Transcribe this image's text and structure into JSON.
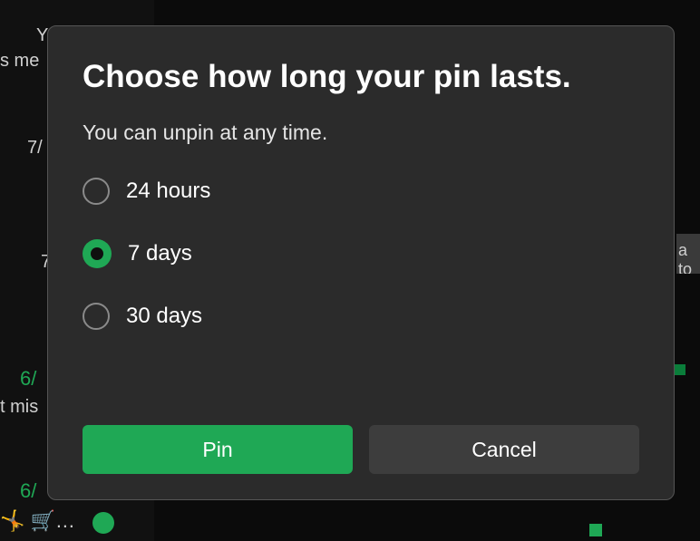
{
  "dialog": {
    "title": "Choose how long your pin lasts.",
    "subtitle": "You can unpin at any time.",
    "options": {
      "opt1": {
        "label": "24 hours",
        "selected": false
      },
      "opt2": {
        "label": "7 days",
        "selected": true
      },
      "opt3": {
        "label": "30 days",
        "selected": false
      }
    },
    "actions": {
      "primary": "Pin",
      "secondary": "Cancel"
    }
  },
  "background": {
    "y": "Y",
    "smsg": "s me",
    "seven1": "7/",
    "seven2": "7",
    "date1": "6/",
    "mis": "t mis",
    "date2": "6/",
    "emoji": "🤸 🛒…",
    "right_strip": "a to"
  }
}
